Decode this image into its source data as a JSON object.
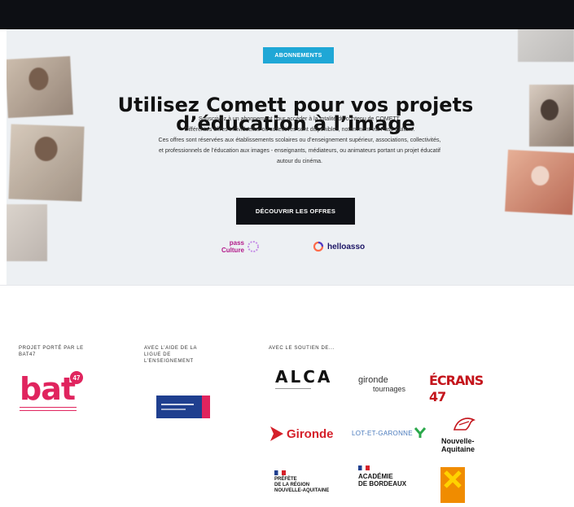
{
  "hero": {
    "tag": "ABONNEMENTS",
    "title_line1": "Utilisez Comett pour vos projets",
    "title_line2": "d’éducation à l’image",
    "desc_lines": [
      "Souscrivez à un abonnement pour accéder à la totalité du contenu de COMETT.",
      "Différentes offres individuelles ou collectives sont disponibles, notamment via Pass Culture.",
      "Ces offres sont réservées aux établissements scolaires ou d’enseignement supérieur, associations, collectivités,",
      "et professionnels de l’éducation aux images - enseignants, médiateurs, ou animateurs portant un projet éducatif",
      "autour du cinéma."
    ],
    "cta_label": "DÉCOUVRIR LES OFFRES",
    "pass_culture_line1": "pass",
    "pass_culture_line2": "Culture",
    "helloasso_label": "helloasso"
  },
  "footer": {
    "col1_heading_line1": "PROJET PORTÉ PAR LE",
    "col1_heading_line2": "BAT47",
    "col2_heading_line1": "AVEC L’AIDE DE LA",
    "col2_heading_line2": "LIGUE DE",
    "col2_heading_line3": "L’ENSEIGNEMENT",
    "col3_heading": "AVEC LE SOUTIEN DE...",
    "bat_logo_text": "bat",
    "bat_logo_sup": "47",
    "alca_text": "ALCA",
    "gironde_tournages_line1": "gironde",
    "gironde_tournages_line2": "tournages",
    "ecrans47_text": "ÉCRANS 47",
    "gironde_text": "Gironde",
    "lot_et_garonne_text": "LOT-ET-GARONNE",
    "nouvelle_aquitaine_line1": "Nouvelle-",
    "nouvelle_aquitaine_line2": "Aquitaine",
    "prefet_line1": "PRÉFÈTE",
    "prefet_line2": "DE LA RÉGION",
    "prefet_line3": "NOUVELLE-AQUITAINE",
    "academie_line1": "ACADÉMIE",
    "academie_line2": "DE BORDEAUX"
  },
  "colors": {
    "accent": "#1fa7d6",
    "dark": "#0d0f14",
    "bat_red": "#e0245e",
    "gironde_red": "#d5202a",
    "ecrans_red": "#c4151c"
  }
}
